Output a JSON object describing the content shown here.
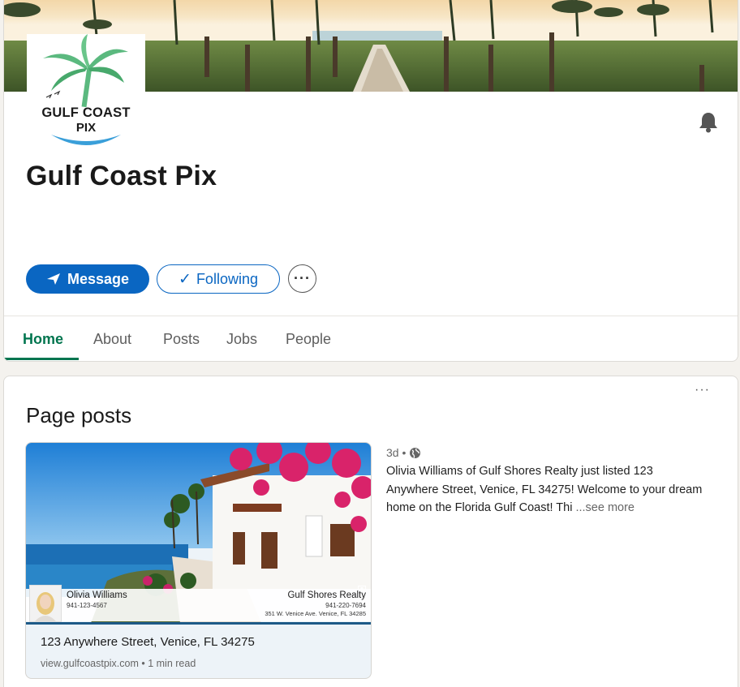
{
  "company": {
    "name": "Gulf Coast Pix",
    "logo_line1": "GULF COAST",
    "logo_line2": "PIX"
  },
  "actions": {
    "message_label": "Message",
    "following_label": "Following",
    "more_label": "···"
  },
  "tabs": [
    {
      "label": "Home",
      "active": true
    },
    {
      "label": "About",
      "active": false
    },
    {
      "label": "Posts",
      "active": false
    },
    {
      "label": "Jobs",
      "active": false
    },
    {
      "label": "People",
      "active": false
    }
  ],
  "posts_section": {
    "title": "Page posts",
    "more_label": "···"
  },
  "post": {
    "time": "3d •",
    "text": "Olivia Williams of Gulf Shores Realty just listed 123 Anywhere Street, Venice, FL 34275! Welcome to your dream home on the Florida Gulf Coast! Thi",
    "see_more": "...see more",
    "card": {
      "agent_name": "Olivia Williams",
      "agent_phone": "941-123-4567",
      "realty_name": "Gulf Shores Realty",
      "realty_phone": "941-220-7694",
      "realty_address": "351 W. Venice Ave. Venice, FL 34285",
      "headline": "123 Anywhere Street, Venice, FL 34275",
      "meta": "view.gulfcoastpix.com • 1 min read"
    }
  },
  "colors": {
    "primary": "#0a66c2",
    "tab_active": "#01754f",
    "background": "#f4f2ee"
  },
  "icons": {
    "bell": "bell-icon",
    "send": "send-icon",
    "check": "check-icon",
    "globe": "globe-icon"
  }
}
